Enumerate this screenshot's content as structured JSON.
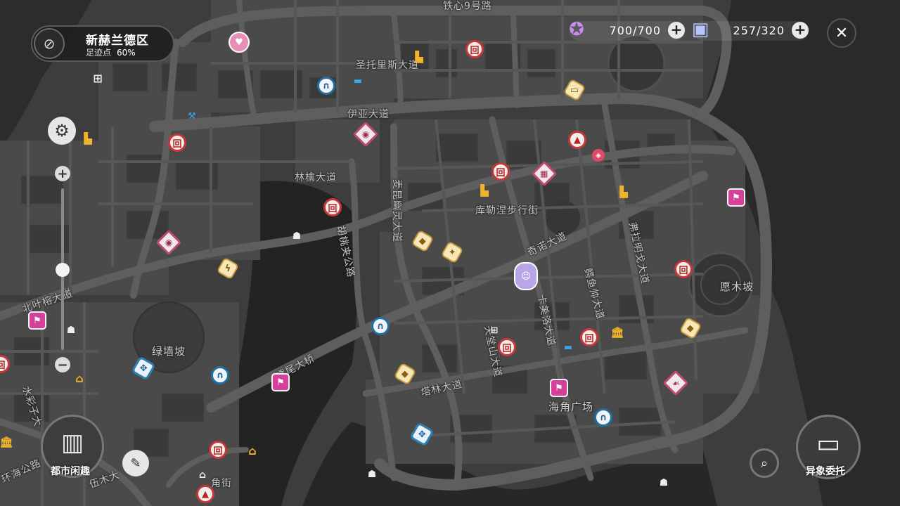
{
  "header": {
    "zone_name": "新赫兰德区",
    "footprint_label": "足迹点",
    "footprint_value": "60%"
  },
  "resources": [
    {
      "icon": "energy-icon",
      "value": "700/700"
    },
    {
      "icon": "ticket-icon",
      "value": "257/320"
    }
  ],
  "buttons": {
    "city_fun": "都市闲趣",
    "anomaly_commission": "异象委托"
  },
  "streets": [
    "铁心9号路",
    "圣托里斯大道",
    "伊亚大道",
    "林檎大道",
    "麦昆幽灵大道",
    "胡桃夹公路",
    "库勒涅步行街",
    "奇诺大道",
    "弗拉明戈大道",
    "鳄鱼帅大道",
    "卡美洛大道",
    "天堂山大道",
    "塔林大道",
    "海角广场",
    "愿木坡",
    "绿墙坡",
    "鸢尾大桥",
    "北叶榕大道",
    "水彩子大",
    "环海公路",
    "伍木大",
    "角街"
  ],
  "colors": {
    "shop_red": "#c8353a",
    "subway_blue": "#1f6fa3",
    "event_pink": "#d63f9a",
    "building_gold": "#f2b32c"
  }
}
